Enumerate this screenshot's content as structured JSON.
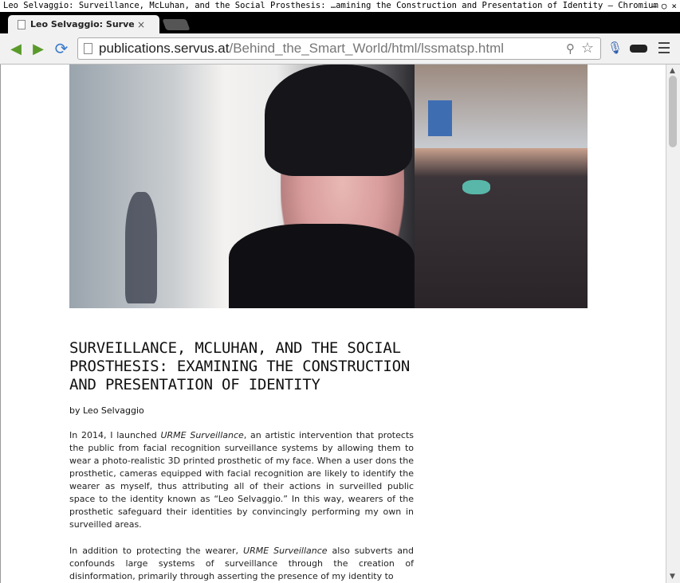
{
  "window": {
    "title": "Leo Selvaggio: Surveillance, McLuhan, and the Social Prosthesis: …amining the Construction and Presentation of Identity – Chromium",
    "buttons": [
      "–",
      "○",
      "×"
    ]
  },
  "tab": {
    "label": "Leo Selvaggio: Surveillance",
    "close": "×"
  },
  "toolbar": {
    "back": "◀",
    "forward": "▶",
    "reload": "⟳",
    "url_host": "publications.servus.at",
    "url_path": "/Behind_the_Smart_World/html/lssmatsp.html",
    "search_glyph": "⚲",
    "star_glyph": "☆",
    "mic_glyph": "🎙"
  },
  "article": {
    "title": "SURVEILLANCE, MCLUHAN, AND THE SOCIAL PROSTHESIS: EXAMINING THE CONSTRUCTION AND PRESENTATION OF IDENTITY",
    "byline": "by Leo Selvaggio",
    "p1_a": "In 2014, I launched ",
    "p1_italic": "URME Surveillance",
    "p1_b": ", an artistic intervention that protects the public from facial recognition surveillance systems by allowing them to wear a photo-realistic 3D printed prosthetic of my face. When a user dons the prosthetic, cameras equipped with facial recognition are likely to identify the wearer as myself, thus attributing all of their actions in surveilled public space to the identity known as “Leo Selvaggio.” In this way, wearers of the prosthetic safeguard their identities by convincingly performing my own in surveilled areas.",
    "p2_a": "In addition to protecting the wearer, ",
    "p2_italic": "URME Surveillance",
    "p2_b": " also subverts and confounds large systems of surveillance through the creation of disinformation, primarily through asserting the presence of my identity to"
  },
  "scrollbar": {
    "up": "▲",
    "down": "▼"
  }
}
